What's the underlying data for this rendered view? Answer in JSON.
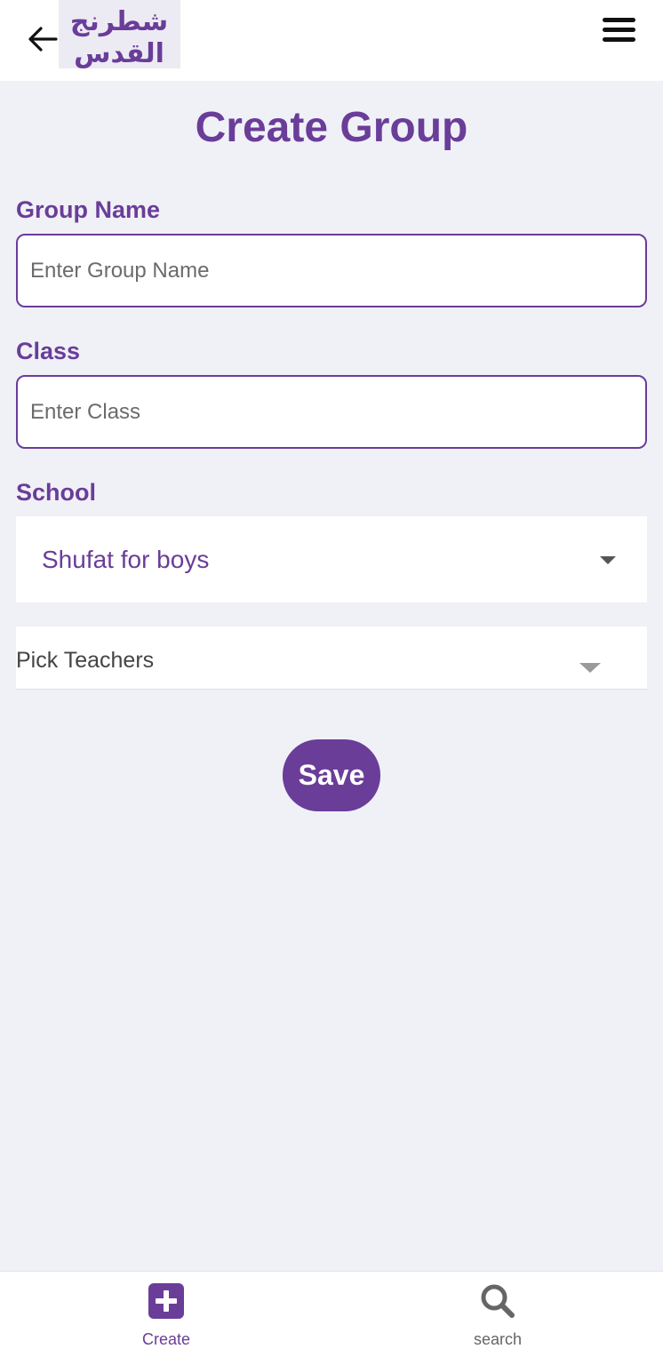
{
  "header": {
    "logo_text": "شطرنج القدس",
    "back_icon": "arrow-left-icon",
    "menu_icon": "hamburger-menu-icon"
  },
  "page": {
    "title": "Create Group"
  },
  "form": {
    "group_name": {
      "label": "Group Name",
      "placeholder": "Enter Group Name",
      "value": ""
    },
    "class": {
      "label": "Class",
      "placeholder": "Enter Class",
      "value": ""
    },
    "school": {
      "label": "School",
      "selected": "Shufat for boys"
    },
    "teachers": {
      "placeholder": "Pick Teachers"
    },
    "save_label": "Save"
  },
  "bottom_nav": {
    "items": [
      {
        "label": "Create",
        "icon": "plus-square-icon",
        "active": true
      },
      {
        "label": "search",
        "icon": "search-icon",
        "active": false
      }
    ]
  },
  "colors": {
    "accent": "#6a3d99",
    "background": "#f0f1f7",
    "surface": "#ffffff"
  }
}
